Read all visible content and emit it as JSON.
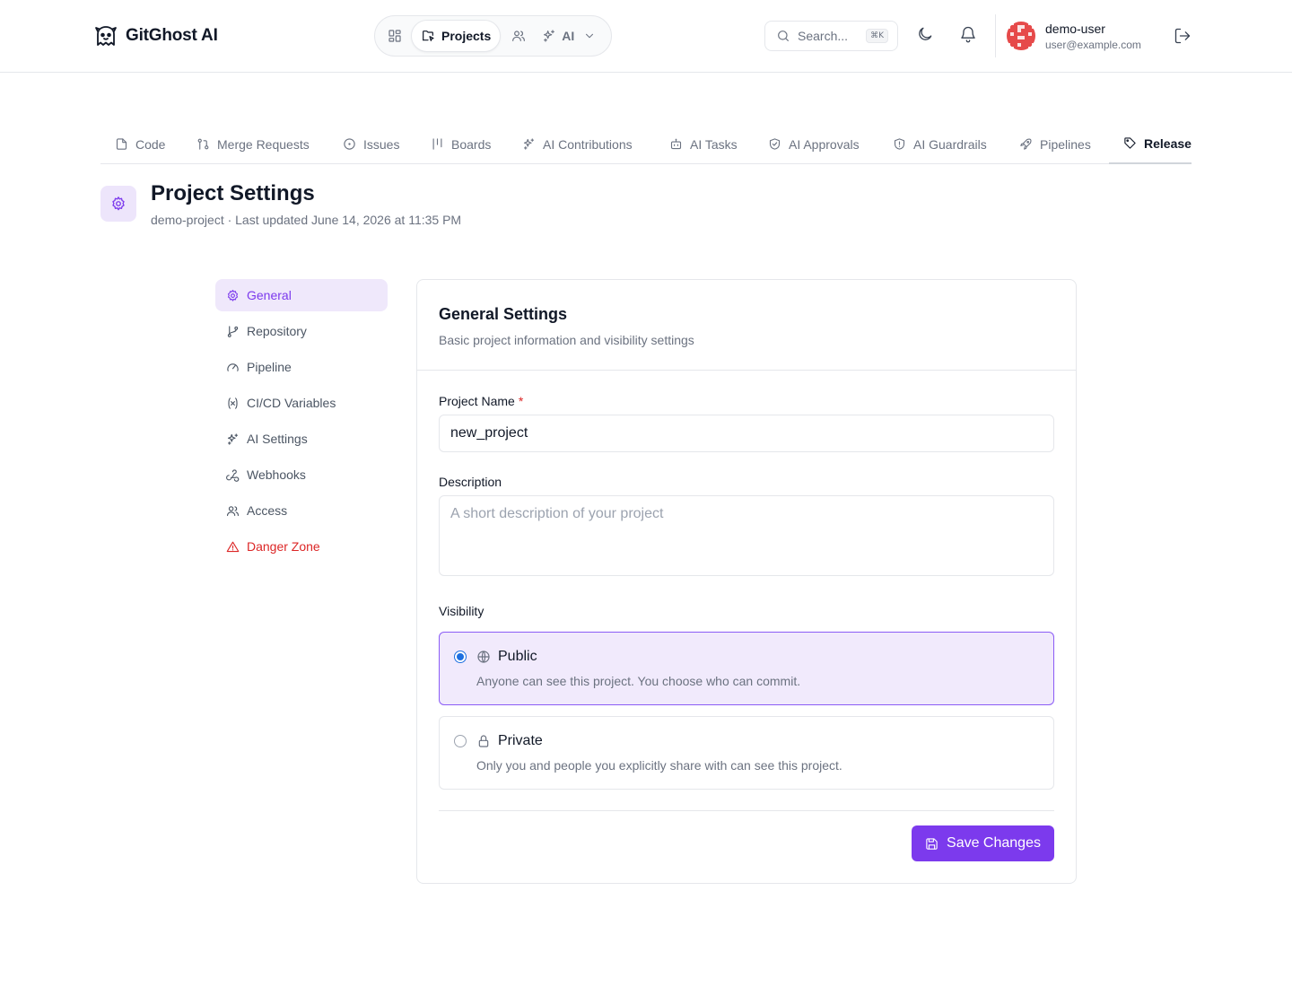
{
  "header": {
    "brand": "GitGhost AI",
    "nav": {
      "active_label": "Projects",
      "ai_label": "AI"
    },
    "search": {
      "placeholder": "Search...",
      "shortcut": "⌘K"
    },
    "user": {
      "name": "demo-user",
      "email": "user@example.com"
    }
  },
  "tabs": [
    {
      "label": "Code",
      "icon": "file-icon"
    },
    {
      "label": "Merge Requests",
      "icon": "git-pull-request-icon"
    },
    {
      "label": "Issues",
      "icon": "circle-dot-icon"
    },
    {
      "label": "Boards",
      "icon": "kanban-icon"
    },
    {
      "label": "AI Contributions",
      "icon": "sparkles-icon"
    },
    {
      "label": "AI Tasks",
      "icon": "bot-icon"
    },
    {
      "label": "AI Approvals",
      "icon": "shield-check-icon"
    },
    {
      "label": "AI Guardrails",
      "icon": "shield-alert-icon"
    },
    {
      "label": "Pipelines",
      "icon": "rocket-icon"
    },
    {
      "label": "Release",
      "icon": "tag-icon"
    }
  ],
  "page": {
    "title": "Project Settings",
    "subtitle": "demo-project · Last updated June 14, 2026 at 11:35 PM"
  },
  "sidenav": [
    {
      "label": "General",
      "icon": "gear-icon"
    },
    {
      "label": "Repository",
      "icon": "git-branch-icon"
    },
    {
      "label": "Pipeline",
      "icon": "gauge-icon"
    },
    {
      "label": "CI/CD Variables",
      "icon": "variable-icon"
    },
    {
      "label": "AI Settings",
      "icon": "sparkles-icon"
    },
    {
      "label": "Webhooks",
      "icon": "webhook-icon"
    },
    {
      "label": "Access",
      "icon": "users-icon"
    },
    {
      "label": "Danger Zone",
      "icon": "warning-icon"
    }
  ],
  "card": {
    "title": "General Settings",
    "description": "Basic project information and visibility settings",
    "project_name": {
      "label": "Project Name",
      "required_mark": "*",
      "value": "new_project"
    },
    "description_field": {
      "label": "Description",
      "placeholder": "A short description of your project",
      "value": ""
    },
    "visibility": {
      "label": "Visibility",
      "options": [
        {
          "title": "Public",
          "desc": "Anyone can see this project. You choose who can commit.",
          "icon": "globe-icon",
          "selected": true
        },
        {
          "title": "Private",
          "desc": "Only you and people you explicitly share with can see this project.",
          "icon": "lock-icon",
          "selected": false
        }
      ]
    },
    "save_label": "Save Changes"
  },
  "colors": {
    "accent": "#7c3aed",
    "accent_light": "#efe8fb",
    "danger": "#dc2626",
    "radio": "#1d6fe0"
  }
}
